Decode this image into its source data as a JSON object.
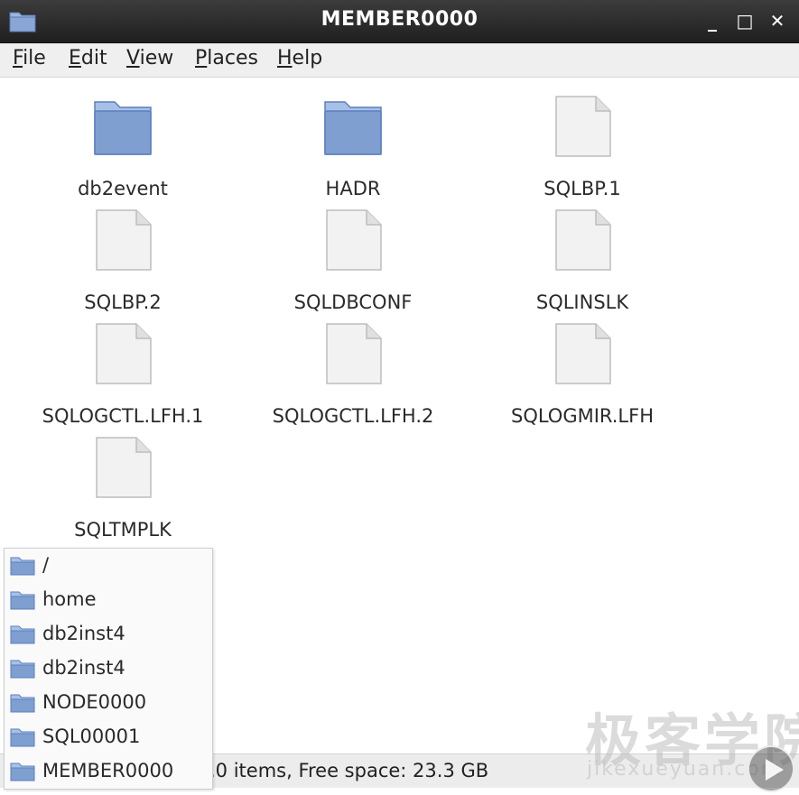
{
  "window": {
    "title": "MEMBER0000",
    "buttons": {
      "minimize": "_",
      "maximize": "□",
      "close": "✕"
    }
  },
  "menu": [
    {
      "label": "File",
      "accel": "F",
      "rest": "ile"
    },
    {
      "label": "Edit",
      "accel": "E",
      "rest": "dit"
    },
    {
      "label": "View",
      "accel": "V",
      "rest": "iew"
    },
    {
      "label": "Places",
      "accel": "P",
      "rest": "laces"
    },
    {
      "label": "Help",
      "accel": "H",
      "rest": "elp"
    }
  ],
  "files": [
    {
      "name": "db2event",
      "type": "folder"
    },
    {
      "name": "HADR",
      "type": "folder"
    },
    {
      "name": "SQLBP.1",
      "type": "file"
    },
    {
      "name": "SQLBP.2",
      "type": "file"
    },
    {
      "name": "SQLDBCONF",
      "type": "file"
    },
    {
      "name": "SQLINSLK",
      "type": "file"
    },
    {
      "name": "SQLOGCTL.LFH.1",
      "type": "file"
    },
    {
      "name": "SQLOGCTL.LFH.2",
      "type": "file"
    },
    {
      "name": "SQLOGMIR.LFH",
      "type": "file"
    },
    {
      "name": "SQLTMPLK",
      "type": "file"
    }
  ],
  "path_menu": [
    "/",
    "home",
    "db2inst4",
    "db2inst4",
    "NODE0000",
    "SQL00001",
    "MEMBER0000"
  ],
  "status": ".0 items, Free space: 23.3 GB",
  "watermark": {
    "cn": "极客学院",
    "en": "jikexueyuan.com"
  },
  "colors": {
    "titlebar": "#2b2b2b",
    "folder": "#7f9fd0",
    "folder_dark": "#5b7fbf"
  },
  "icons": {
    "folder": "folder-icon",
    "file": "file-icon",
    "play": "play-icon"
  }
}
